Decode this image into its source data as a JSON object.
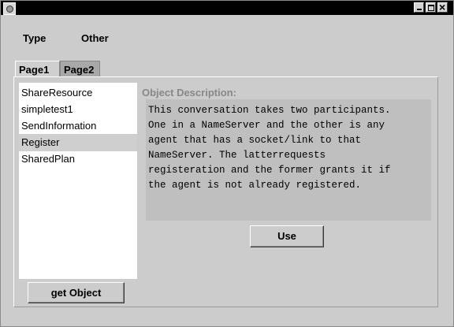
{
  "window": {
    "minimize_icon": "minimize-icon",
    "maximize_icon": "maximize-icon",
    "close_icon": "close-icon",
    "app_icon": "app-icon"
  },
  "menu": {
    "items": [
      {
        "label": "Type"
      },
      {
        "label": "Other"
      }
    ]
  },
  "tabs": [
    {
      "label": "Page1",
      "active": true
    },
    {
      "label": "Page2",
      "active": false
    }
  ],
  "objects": {
    "items": [
      {
        "label": "ShareResource"
      },
      {
        "label": "simpletest1"
      },
      {
        "label": "SendInformation"
      },
      {
        "label": "Register",
        "selected": true
      },
      {
        "label": "SharedPlan"
      }
    ],
    "get_button": "get Object"
  },
  "description": {
    "label": "Object Description:",
    "text": "This conversation takes two participants.\nOne in a NameServer and the other is any\nagent that has a socket/link to that\nNameServer.  The latterrequests\nregisteration and the former grants it if\nthe agent is not already registered."
  },
  "use_button": "Use"
}
